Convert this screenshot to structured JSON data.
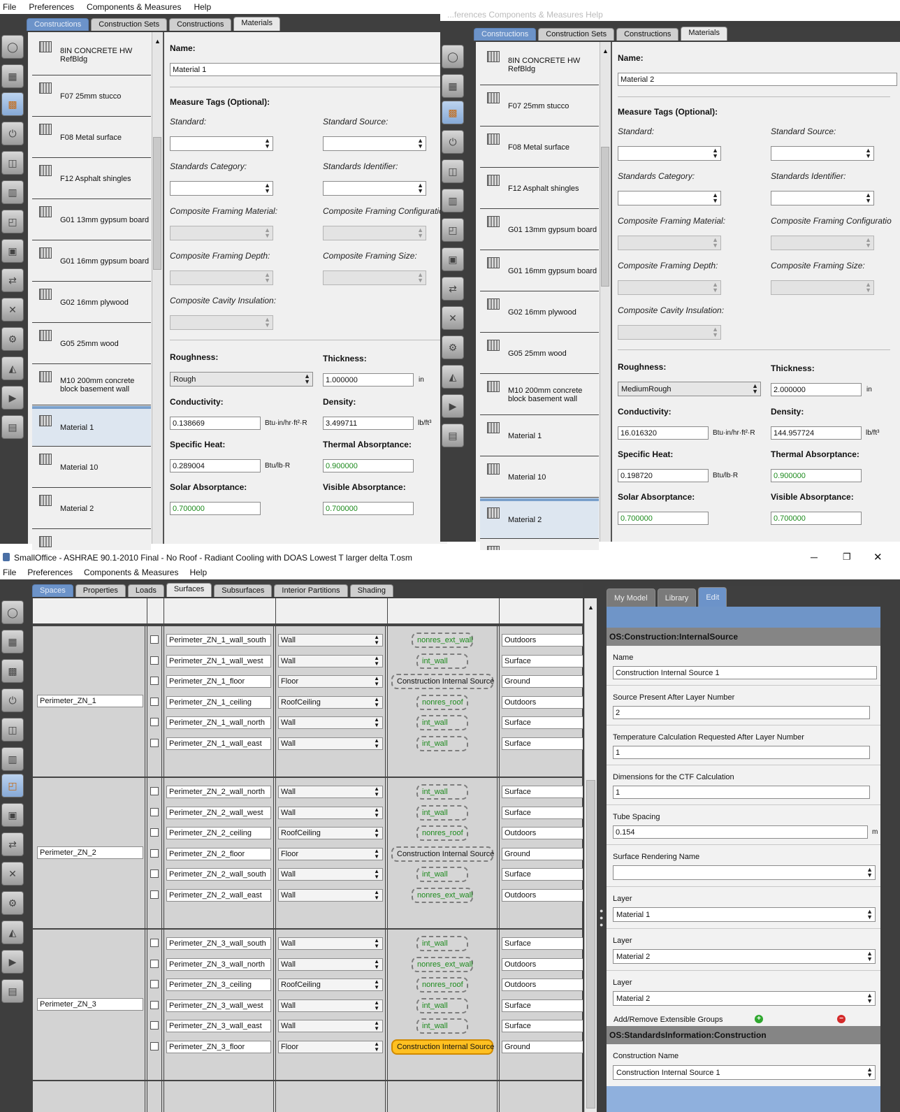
{
  "top_left": {
    "menu": [
      "File",
      "Preferences",
      "Components & Measures",
      "Help"
    ],
    "tabs": [
      "Constructions",
      "Construction Sets",
      "Constructions",
      "Materials"
    ],
    "materials": [
      "8IN CONCRETE HW RefBldg",
      "F07 25mm stucco",
      "F08 Metal surface",
      "F12 Asphalt shingles",
      "G01 13mm gypsum board",
      "G01 16mm gypsum board",
      "G02 16mm plywood",
      "G05 25mm wood",
      "M10 200mm concrete block basement wall",
      "Material 1",
      "Material 10",
      "Material 2"
    ],
    "form": {
      "name_label": "Name:",
      "name_value": "Material 1",
      "measure_tags": "Measure Tags (Optional):",
      "standard": "Standard:",
      "standard_source": "Standard Source:",
      "standards_category": "Standards Category:",
      "standards_identifier": "Standards Identifier:",
      "cf_material": "Composite Framing Material:",
      "cf_config": "Composite Framing Configuratio",
      "cf_depth": "Composite Framing Depth:",
      "cf_size": "Composite Framing Size:",
      "cavity": "Composite Cavity Insulation:",
      "roughness": "Roughness:",
      "roughness_value": "Rough",
      "thickness": "Thickness:",
      "thickness_value": "1.000000",
      "thickness_unit": "in",
      "conductivity": "Conductivity:",
      "conductivity_value": "0.138669",
      "conductivity_unit": "Btu·in/hr·ft²·R",
      "density": "Density:",
      "density_value": "3.499711",
      "density_unit": "lb/ft³",
      "specific_heat": "Specific Heat:",
      "specific_heat_value": "0.289004",
      "specific_heat_unit": "Btu/lb·R",
      "thermal_abs": "Thermal Absorptance:",
      "thermal_abs_value": "0.900000",
      "solar_abs": "Solar Absorptance:",
      "solar_abs_value": "0.700000",
      "visible_abs": "Visible Absorptance:",
      "visible_abs_value": "0.700000"
    }
  },
  "top_right": {
    "menu_fragment": "...ferences  Components & Measures  Help",
    "tabs": [
      "Constructions",
      "Construction Sets",
      "Constructions",
      "Materials"
    ],
    "materials": [
      "8IN CONCRETE HW RefBldg",
      "F07 25mm stucco",
      "F08 Metal surface",
      "F12 Asphalt shingles",
      "G01 13mm gypsum board",
      "G01 16mm gypsum board",
      "G02 16mm plywood",
      "G05 25mm wood",
      "M10 200mm concrete block basement wall",
      "Material 1",
      "Material 10",
      "Material 2"
    ],
    "form": {
      "name_label": "Name:",
      "name_value": "Material 2",
      "measure_tags": "Measure Tags (Optional):",
      "standard": "Standard:",
      "standard_source": "Standard Source:",
      "standards_category": "Standards Category:",
      "standards_identifier": "Standards Identifier:",
      "cf_material": "Composite Framing Material:",
      "cf_config": "Composite Framing Configuratio",
      "cf_depth": "Composite Framing Depth:",
      "cf_size": "Composite Framing Size:",
      "cavity": "Composite Cavity Insulation:",
      "roughness": "Roughness:",
      "roughness_value": "MediumRough",
      "thickness": "Thickness:",
      "thickness_value": "2.000000",
      "thickness_unit": "in",
      "conductivity": "Conductivity:",
      "conductivity_value": "16.016320",
      "conductivity_unit": "Btu·in/hr·ft²·R",
      "density": "Density:",
      "density_value": "144.957724",
      "density_unit": "lb/ft³",
      "specific_heat": "Specific Heat:",
      "specific_heat_value": "0.198720",
      "specific_heat_unit": "Btu/lb·R",
      "thermal_abs": "Thermal Absorptance:",
      "thermal_abs_value": "0.900000",
      "solar_abs": "Solar Absorptance:",
      "solar_abs_value": "0.700000",
      "visible_abs": "Visible Absorptance:",
      "visible_abs_value": "0.700000"
    }
  },
  "bottom": {
    "title": "SmallOffice - ASHRAE 90.1-2010 Final - No Roof - Radiant Cooling with DOAS Lowest T larger delta T.osm",
    "menu": [
      "File",
      "Preferences",
      "Components & Measures",
      "Help"
    ],
    "tabs": [
      "Spaces",
      "Properties",
      "Loads",
      "Surfaces",
      "Subsurfaces",
      "Interior Partitions",
      "Shading"
    ],
    "spaces": [
      {
        "name": "Perimeter_ZN_1",
        "rows": [
          {
            "surface": "Perimeter_ZN_1_wall_south",
            "type": "Wall",
            "construction": "nonres_ext_wall",
            "bc": "Outdoors",
            "style": "green"
          },
          {
            "surface": "Perimeter_ZN_1_wall_west",
            "type": "Wall",
            "construction": "int_wall",
            "bc": "Surface",
            "style": "green"
          },
          {
            "surface": "Perimeter_ZN_1_floor",
            "type": "Floor",
            "construction": "Construction Internal Source",
            "bc": "Ground",
            "style": "black"
          },
          {
            "surface": "Perimeter_ZN_1_ceiling",
            "type": "RoofCeiling",
            "construction": "nonres_roof",
            "bc": "Outdoors",
            "style": "green"
          },
          {
            "surface": "Perimeter_ZN_1_wall_north",
            "type": "Wall",
            "construction": "int_wall",
            "bc": "Surface",
            "style": "green"
          },
          {
            "surface": "Perimeter_ZN_1_wall_east",
            "type": "Wall",
            "construction": "int_wall",
            "bc": "Surface",
            "style": "green"
          }
        ]
      },
      {
        "name": "Perimeter_ZN_2",
        "rows": [
          {
            "surface": "Perimeter_ZN_2_wall_north",
            "type": "Wall",
            "construction": "int_wall",
            "bc": "Surface",
            "style": "green"
          },
          {
            "surface": "Perimeter_ZN_2_wall_west",
            "type": "Wall",
            "construction": "int_wall",
            "bc": "Surface",
            "style": "green"
          },
          {
            "surface": "Perimeter_ZN_2_ceiling",
            "type": "RoofCeiling",
            "construction": "nonres_roof",
            "bc": "Outdoors",
            "style": "green"
          },
          {
            "surface": "Perimeter_ZN_2_floor",
            "type": "Floor",
            "construction": "Construction Internal Source",
            "bc": "Ground",
            "style": "black"
          },
          {
            "surface": "Perimeter_ZN_2_wall_south",
            "type": "Wall",
            "construction": "int_wall",
            "bc": "Surface",
            "style": "green"
          },
          {
            "surface": "Perimeter_ZN_2_wall_east",
            "type": "Wall",
            "construction": "nonres_ext_wall",
            "bc": "Outdoors",
            "style": "green"
          }
        ]
      },
      {
        "name": "Perimeter_ZN_3",
        "rows": [
          {
            "surface": "Perimeter_ZN_3_wall_south",
            "type": "Wall",
            "construction": "int_wall",
            "bc": "Surface",
            "style": "green"
          },
          {
            "surface": "Perimeter_ZN_3_wall_north",
            "type": "Wall",
            "construction": "nonres_ext_wall",
            "bc": "Outdoors",
            "style": "green"
          },
          {
            "surface": "Perimeter_ZN_3_ceiling",
            "type": "RoofCeiling",
            "construction": "nonres_roof",
            "bc": "Outdoors",
            "style": "green"
          },
          {
            "surface": "Perimeter_ZN_3_wall_west",
            "type": "Wall",
            "construction": "int_wall",
            "bc": "Surface",
            "style": "green"
          },
          {
            "surface": "Perimeter_ZN_3_wall_east",
            "type": "Wall",
            "construction": "int_wall",
            "bc": "Surface",
            "style": "green"
          },
          {
            "surface": "Perimeter_ZN_3_floor",
            "type": "Floor",
            "construction": "Construction Internal Source",
            "bc": "Ground",
            "style": "orange"
          }
        ]
      }
    ],
    "right_tabs": [
      "My Model",
      "Library",
      "Edit"
    ],
    "inspector": {
      "section1": "OS:Construction:InternalSource",
      "name_label": "Name",
      "name_value": "Construction Internal Source 1",
      "source_label": "Source Present After Layer Number",
      "source_value": "2",
      "temp_label": "Temperature Calculation Requested After Layer Number",
      "temp_value": "1",
      "dim_label": "Dimensions for the CTF Calculation",
      "dim_value": "1",
      "tube_label": "Tube Spacing",
      "tube_value": "0.154",
      "tube_unit": "m",
      "render_label": "Surface Rendering Name",
      "render_value": "",
      "layers": [
        {
          "label": "Layer",
          "value": "Material 1"
        },
        {
          "label": "Layer",
          "value": "Material 2"
        },
        {
          "label": "Layer",
          "value": "Material 2"
        }
      ],
      "ext_groups": "Add/Remove Extensible Groups",
      "section2": "OS:StandardsInformation:Construction",
      "cname_label": "Construction Name",
      "cname_value": "Construction Internal Source 1"
    }
  },
  "colors": {
    "accent": "#6c93c9",
    "dark": "#3e3e3e",
    "green_text": "#1c8a1c",
    "highlight": "#ffc021"
  }
}
